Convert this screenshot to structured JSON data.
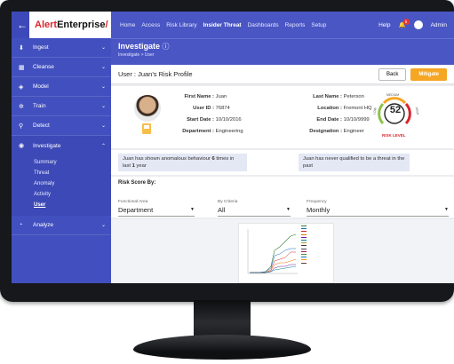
{
  "brand": {
    "name_prefix": "Alert",
    "name_suffix": "Enterprise",
    "slash": "/"
  },
  "nav": [
    "Home",
    "Access",
    "Risk Library",
    "Insider Threat",
    "Dashboards",
    "Reports",
    "Setup"
  ],
  "nav_active": "Insider Threat",
  "header_right": {
    "help": "Help",
    "notifications": "5",
    "user": "Admin"
  },
  "sidebar": {
    "items": [
      {
        "label": "Ingest",
        "icon": "ingest-icon"
      },
      {
        "label": "Cleanse",
        "icon": "cleanse-icon"
      },
      {
        "label": "Model",
        "icon": "model-icon"
      },
      {
        "label": "Train",
        "icon": "train-icon"
      },
      {
        "label": "Detect",
        "icon": "detect-icon"
      },
      {
        "label": "Investigate",
        "icon": "eye-icon"
      },
      {
        "label": "Analyze",
        "icon": "analyze-icon"
      }
    ],
    "investigate_sub": [
      "Summary",
      "Threat",
      "Anomaly",
      "Activity",
      "User"
    ]
  },
  "page": {
    "title": "Investigate",
    "breadcrumb": "Investigate > User",
    "profile_title": "User : Juan's Risk Profile"
  },
  "buttons": {
    "back": "Back",
    "mitigate": "Mitigate"
  },
  "profile": {
    "first_name_label": "First Name :",
    "first_name": "Juan",
    "user_id_label": "User ID :",
    "user_id": "76874",
    "start_date_label": "Start Date :",
    "start_date": "10/10/2016",
    "department_label": "Department :",
    "department": "Engineering",
    "last_name_label": "Last Name :",
    "last_name": "Peterson",
    "location_label": "Location :",
    "location": "Fremont HQ",
    "end_date_label": "End Date :",
    "end_date": "10/10/9999",
    "designation_label": "Designation :",
    "designation": "Engineer"
  },
  "risk_gauge": {
    "value": "52",
    "label": "RISK LEVEL",
    "low": "LOW",
    "medium": "MEDIUM",
    "high": "HIGH",
    "colors": {
      "low": "#8bc34a",
      "medium": "#f5a623",
      "high": "#d8262c"
    }
  },
  "alerts": {
    "a1_pre": "Juan has shown anomalous behaviour ",
    "a1_bold": "6",
    "a1_mid": " times in last ",
    "a1_bold2": "1",
    "a1_post": " year",
    "a2": "Juan has never qualified to be a threat in the past"
  },
  "risk_score": {
    "title": "Risk Score By:",
    "functional_area_label": "Functional Area",
    "functional_area": "Department",
    "criteria_label": "By Criteria",
    "criteria": "All",
    "frequency_label": "Frequency",
    "frequency": "Monthly"
  },
  "colors": {
    "topbar": "#4a56c4",
    "sidebar": "#4250bf",
    "accent": "#f5a623",
    "brand_red": "#d8262c"
  }
}
